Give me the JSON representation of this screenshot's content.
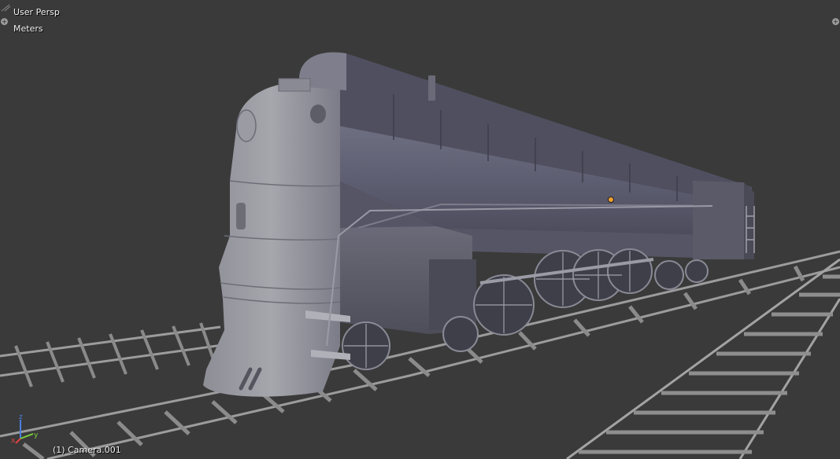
{
  "viewport": {
    "view_name": "User Persp",
    "units": "Meters",
    "active_object_label": "(1) Camera.001"
  },
  "axis_gizmo": {
    "x_label": "x",
    "y_label": "y",
    "z_label": "z",
    "x_color": "#e04040",
    "y_color": "#7ad13b",
    "z_color": "#4a7fe0"
  },
  "corner_widgets": {
    "plus_symbol": "+"
  },
  "colors": {
    "background": "#3a3a3a",
    "mesh": "#8d8d9a",
    "mesh_dark": "#5f5f6e",
    "rail": "#9a9a9a",
    "origin_dot": "#f0a030"
  }
}
